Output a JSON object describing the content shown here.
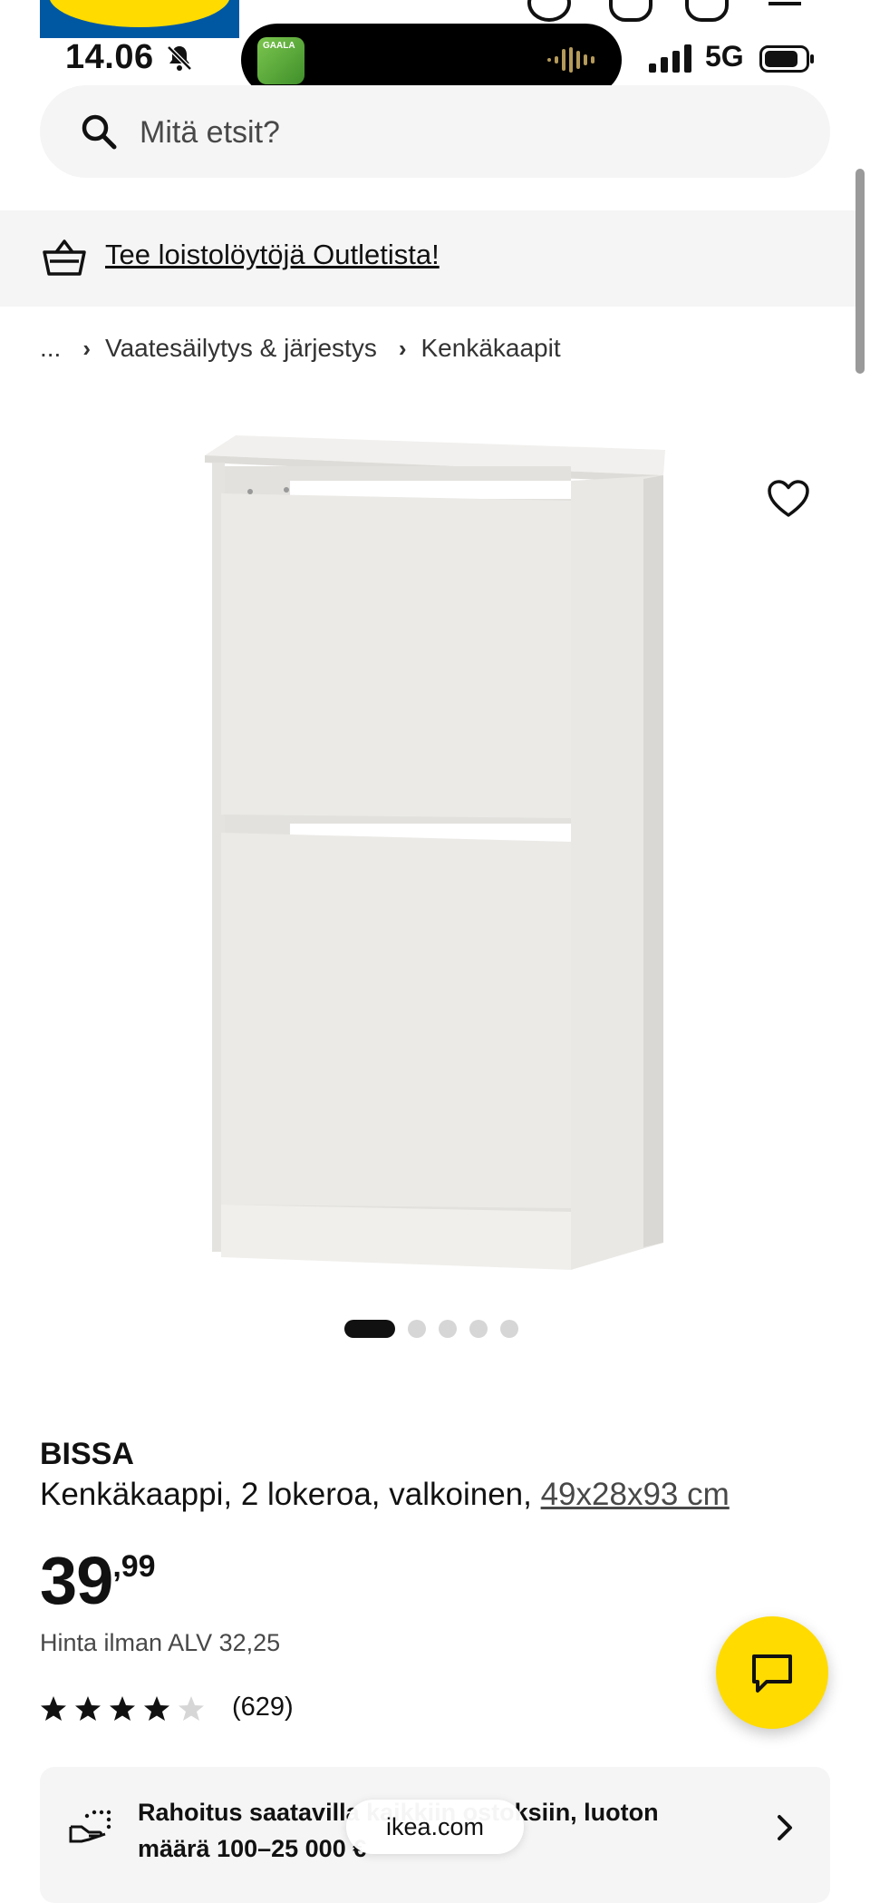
{
  "status_bar": {
    "time": "14.06",
    "network": "5G",
    "now_playing_art_text": "GAALA"
  },
  "search": {
    "placeholder": "Mitä etsit?"
  },
  "banner": {
    "link_text": "Tee loistolöytöjä Outletista!"
  },
  "breadcrumb": {
    "items": [
      "...",
      "Vaatesäilytys & järjestys",
      "Kenkäkaapit"
    ]
  },
  "carousel": {
    "total": 5,
    "active": 1
  },
  "product": {
    "name": "BISSA",
    "description": "Kenkäkaappi, 2 lokeroa, valkoinen, ",
    "dimensions": "49x28x93 cm",
    "price_int": "39",
    "price_dec": ",99",
    "vat_text": "Hinta ilman ALV 32,25",
    "rating": 4.5,
    "review_count": "(629)"
  },
  "financing": {
    "text": "Rahoitus saatavilla kaikkiin ostoksiin, luoton määrä 100–25 000 €"
  },
  "browser": {
    "url": "ikea.com"
  },
  "colors": {
    "brand_blue": "#0058a3",
    "brand_yellow": "#ffdb00",
    "surface": "#f5f5f5"
  }
}
